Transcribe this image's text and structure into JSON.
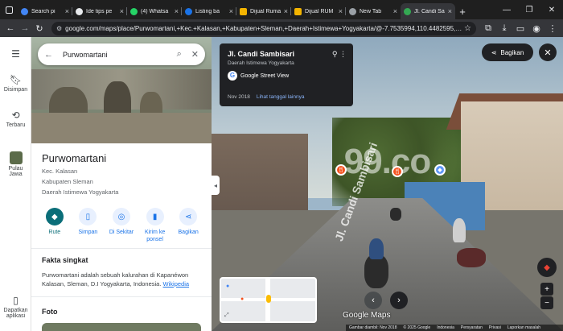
{
  "browser": {
    "tabs": [
      {
        "label": "Search pi",
        "color": "#4285f4",
        "active": false
      },
      {
        "label": "Ide tips pe",
        "color": "#e8eaed",
        "active": false
      },
      {
        "label": "(4) Whatsa",
        "color": "#25d366",
        "active": false
      },
      {
        "label": "Listing ba",
        "color": "#1a73e8",
        "active": false
      },
      {
        "label": "Dijual Ruma",
        "color": "#f4b400",
        "active": false
      },
      {
        "label": "Dijual RUM",
        "color": "#f4b400",
        "active": false
      },
      {
        "label": "New Tab",
        "color": "#9aa0a6",
        "active": false
      },
      {
        "label": "Jl. Candi Sa",
        "color": "#34a853",
        "active": true
      }
    ],
    "new_tab_label": "+",
    "url": "google.com/maps/place/Purwomartani,+Kec.+Kalasan,+Kabupaten+Sleman,+Daerah+Istimewa+Yogyakarta/@-7.7535994,110.4482595,3a,..."
  },
  "rail": {
    "items": [
      {
        "label": "Disimpan"
      },
      {
        "label": "Terbaru"
      },
      {
        "label": "Pulau Jawa"
      },
      {
        "label": "Dapatkan aplikasi"
      }
    ]
  },
  "search": {
    "query": "Purwomartani"
  },
  "place": {
    "title": "Purwomartani",
    "lines": [
      "Kec. Kalasan",
      "Kabupaten Sleman",
      "Daerah Istimewa Yogyakarta"
    ],
    "actions": [
      {
        "label": "Rute",
        "icon": "directions-icon"
      },
      {
        "label": "Simpan",
        "icon": "bookmark-icon"
      },
      {
        "label": "Di Sekitar",
        "icon": "nearby-icon"
      },
      {
        "label": "Kirim ke ponsel",
        "icon": "phone-icon"
      },
      {
        "label": "Bagikan",
        "icon": "share-icon"
      }
    ],
    "facts_heading": "Fakta singkat",
    "facts_text": "Purwomartani adalah sebuah kalurahan di Kapanéwon Kalasan, Sleman, D.I Yogyakarta, Indonesia.",
    "facts_link": "Wikipedia",
    "photo_heading": "Foto"
  },
  "streetview": {
    "street": "Jl. Candi Sambisari",
    "region": "Daerah Istimewa Yogyakarta",
    "provider": "Google Street View",
    "date": "Nov 2018",
    "more_dates": "Lihat tanggal lainnya",
    "share_label": "Bagikan",
    "watermark": "99.co",
    "road_text": "Jl. Candi Sambisari",
    "logo": "Google Maps",
    "attribution": [
      "Gambar diambil: Nov 2018",
      "© 2025 Google",
      "Indonesia",
      "Persyaratan",
      "Privasi",
      "Laporkan masalah"
    ]
  }
}
